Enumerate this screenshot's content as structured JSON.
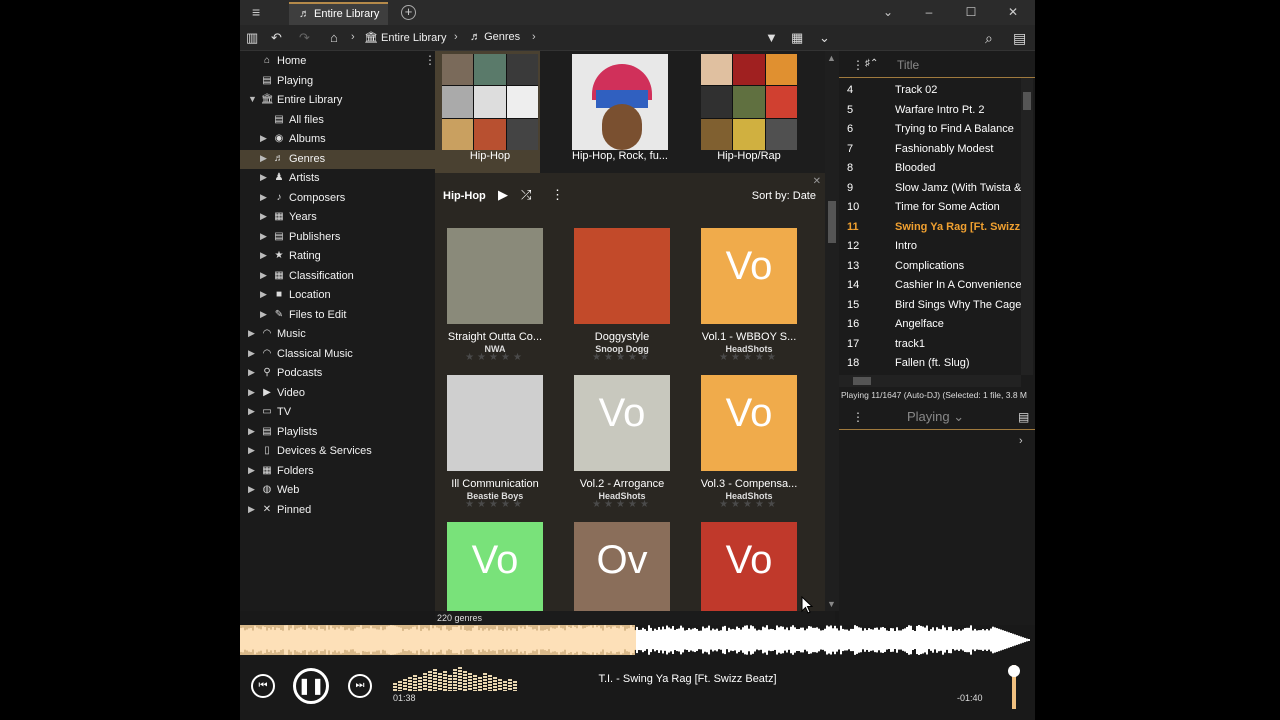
{
  "colors": {
    "accent": "#f0a030",
    "selection": "#4a4131",
    "panel": "#1b1b1b",
    "content": "#2a2722",
    "wave_played": "#fde0b8"
  },
  "titlebar": {
    "tab_label": "Entire Library"
  },
  "toolbar": {
    "crumbs": [
      "Entire Library",
      "Genres"
    ]
  },
  "sidebar": {
    "items": [
      {
        "label": "Home",
        "icon": "home-icon"
      },
      {
        "label": "Playing",
        "icon": "playlist-icon"
      },
      {
        "label": "Entire Library",
        "icon": "library-icon"
      },
      {
        "label": "All files",
        "icon": "files-icon"
      },
      {
        "label": "Albums",
        "icon": "disc-icon"
      },
      {
        "label": "Genres",
        "icon": "genre-icon"
      },
      {
        "label": "Artists",
        "icon": "artist-icon"
      },
      {
        "label": "Composers",
        "icon": "note-icon"
      },
      {
        "label": "Years",
        "icon": "calendar-icon"
      },
      {
        "label": "Publishers",
        "icon": "publisher-icon"
      },
      {
        "label": "Rating",
        "icon": "star-icon"
      },
      {
        "label": "Classification",
        "icon": "classification-icon"
      },
      {
        "label": "Location",
        "icon": "folder-icon"
      },
      {
        "label": "Files to Edit",
        "icon": "edit-icon"
      },
      {
        "label": "Music",
        "icon": "headphones-icon"
      },
      {
        "label": "Classical Music",
        "icon": "headphones-icon"
      },
      {
        "label": "Podcasts",
        "icon": "podcast-icon"
      },
      {
        "label": "Video",
        "icon": "video-icon"
      },
      {
        "label": "TV",
        "icon": "tv-icon"
      },
      {
        "label": "Playlists",
        "icon": "playlist-icon"
      },
      {
        "label": "Devices & Services",
        "icon": "device-icon"
      },
      {
        "label": "Folders",
        "icon": "folders-icon"
      },
      {
        "label": "Web",
        "icon": "globe-icon"
      },
      {
        "label": "Pinned",
        "icon": "pin-icon"
      }
    ]
  },
  "genres": [
    {
      "label": "Hip-Hop"
    },
    {
      "label": "Hip-Hop, Rock, fu..."
    },
    {
      "label": "Hip-Hop/Rap"
    }
  ],
  "subbar": {
    "genre": "Hip-Hop",
    "sort_label": "Sort by:",
    "sort_value": "Date"
  },
  "albums": [
    {
      "title": "Straight Outta Co...",
      "artist": "NWA",
      "placeholder": "",
      "color": "#8a8a7a"
    },
    {
      "title": "Doggystyle",
      "artist": "Snoop Dogg",
      "placeholder": "",
      "color": "#c24a2a"
    },
    {
      "title": "Vol.1 - WBBOY S...",
      "artist": "HeadShots",
      "placeholder": "Vo",
      "color": "#f0ab4b"
    },
    {
      "title": "Ill Communication",
      "artist": "Beastie Boys",
      "placeholder": "",
      "color": "#cfcfcf"
    },
    {
      "title": "Vol.2 - Arrogance",
      "artist": "HeadShots",
      "placeholder": "Vo",
      "color": "#c8c8be"
    },
    {
      "title": "Vol.3 - Compensa...",
      "artist": "HeadShots",
      "placeholder": "Vo",
      "color": "#f0ab4b"
    },
    {
      "title": "",
      "artist": "",
      "placeholder": "Vo",
      "color": "#79e27a"
    },
    {
      "title": "",
      "artist": "",
      "placeholder": "Ov",
      "color": "#8a6e5a"
    },
    {
      "title": "",
      "artist": "",
      "placeholder": "Vo",
      "color": "#c0392b"
    }
  ],
  "status": {
    "count": "220 genres"
  },
  "tracklist": {
    "column": "Title",
    "tracks": [
      {
        "no": "4",
        "title": "Track 02"
      },
      {
        "no": "5",
        "title": "Warfare Intro Pt. 2"
      },
      {
        "no": "6",
        "title": "Trying to Find A Balance"
      },
      {
        "no": "7",
        "title": "Fashionably Modest"
      },
      {
        "no": "8",
        "title": "Blooded"
      },
      {
        "no": "9",
        "title": "Slow Jamz (With Twista & "
      },
      {
        "no": "10",
        "title": "Time for Some Action"
      },
      {
        "no": "11",
        "title": "Swing Ya Rag [Ft. Swizz B"
      },
      {
        "no": "12",
        "title": "Intro"
      },
      {
        "no": "13",
        "title": "Complications"
      },
      {
        "no": "14",
        "title": "Cashier In A Convenience"
      },
      {
        "no": "15",
        "title": "Bird Sings Why The Caged"
      },
      {
        "no": "16",
        "title": "Angelface"
      },
      {
        "no": "17",
        "title": "track1"
      },
      {
        "no": "18",
        "title": "Fallen (ft. Slug)"
      }
    ],
    "playing_index": 7,
    "info": "Playing 11/1647 (Auto-DJ) (Selected: 1 file, 3.8 M"
  },
  "playing_panel": {
    "label": "Playing"
  },
  "player": {
    "elapsed": "01:38",
    "remaining": "-01:40",
    "now_playing": "T.I. - Swing Ya Rag [Ft. Swizz Beatz]",
    "progress": 0.5,
    "volume": 1.0
  }
}
